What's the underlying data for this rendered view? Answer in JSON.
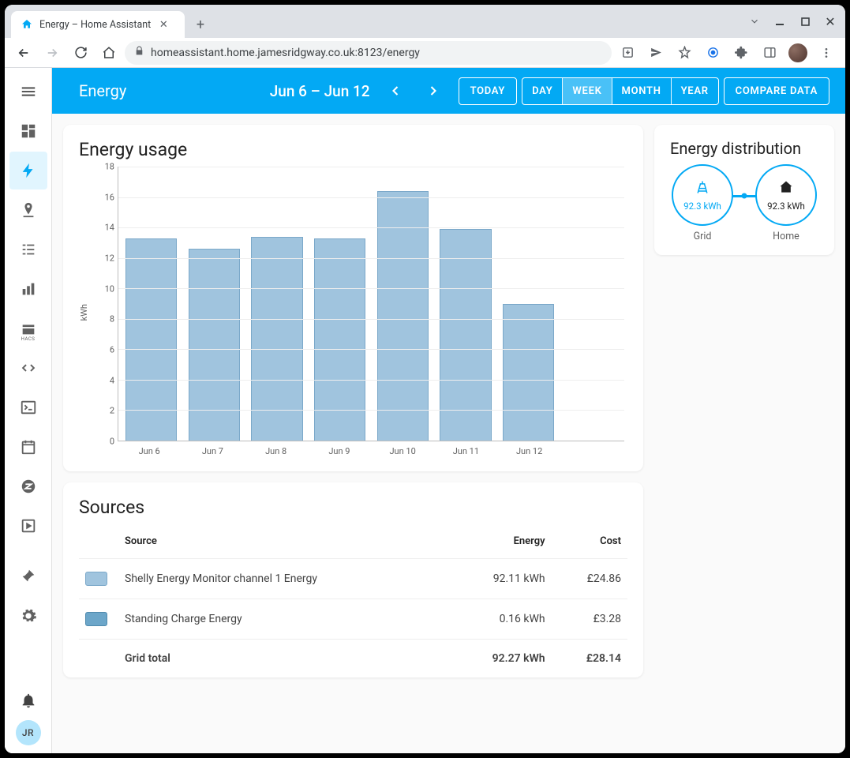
{
  "browser": {
    "tab_title": "Energy – Home Assistant",
    "url": "homeassistant.home.jamesridgway.co.uk:8123/energy"
  },
  "header": {
    "title": "Energy",
    "date_range": "Jun 6 – Jun 12",
    "today": "TODAY",
    "periods": [
      "DAY",
      "WEEK",
      "MONTH",
      "YEAR"
    ],
    "active_period_index": 1,
    "compare": "COMPARE DATA"
  },
  "sidebar_user_initials": "JR",
  "energy_usage_title": "Energy usage",
  "distribution": {
    "title": "Energy distribution",
    "grid_label": "Grid",
    "grid_value": "92.3 kWh",
    "home_label": "Home",
    "home_value": "92.3 kWh"
  },
  "sources": {
    "title": "Sources",
    "headers": {
      "source": "Source",
      "energy": "Energy",
      "cost": "Cost"
    },
    "rows": [
      {
        "color": "#a0c4de",
        "border": "#7ba8c9",
        "name": "Shelly Energy Monitor channel 1 Energy",
        "energy": "92.11 kWh",
        "cost": "£24.86"
      },
      {
        "color": "#6ca6c9",
        "border": "#4f8aad",
        "name": "Standing Charge Energy",
        "energy": "0.16 kWh",
        "cost": "£3.28"
      }
    ],
    "total": {
      "label": "Grid total",
      "energy": "92.27 kWh",
      "cost": "£28.14"
    }
  },
  "chart_data": {
    "type": "bar",
    "title": "Energy usage",
    "ylabel": "kWh",
    "ylim": [
      0,
      18
    ],
    "yticks": [
      0,
      2,
      4,
      6,
      8,
      10,
      12,
      14,
      16,
      18
    ],
    "categories": [
      "Jun 6",
      "Jun 7",
      "Jun 8",
      "Jun 9",
      "Jun 10",
      "Jun 11",
      "Jun 12"
    ],
    "values": [
      13.3,
      12.6,
      13.4,
      13.3,
      16.4,
      13.9,
      9.0
    ]
  }
}
